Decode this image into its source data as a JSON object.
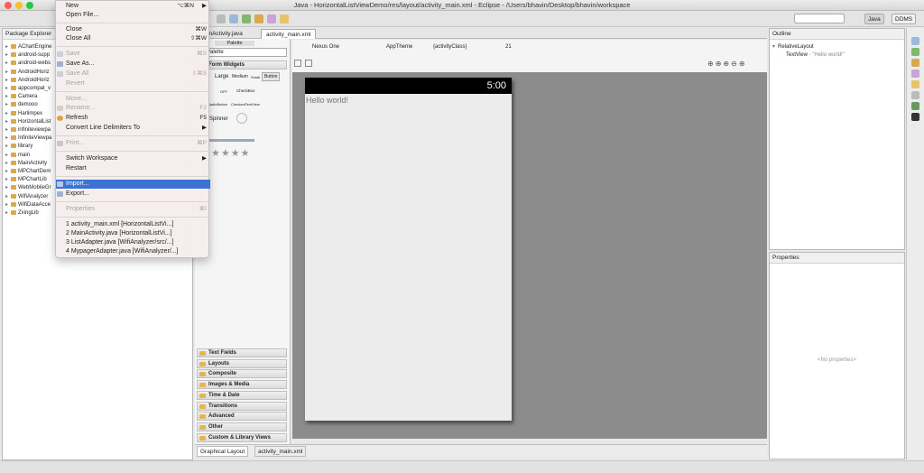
{
  "window": {
    "title": "Java - HorizontalListViewDemo/res/layout/activity_main.xml - Eclipse - /Users/bhavin/Desktop/bhavin/workspace"
  },
  "toolbar": {
    "perspectives": [
      {
        "label": "Java",
        "active": true
      },
      {
        "label": "DDMS",
        "active": false
      }
    ]
  },
  "package_explorer": {
    "title": "Package Explorer",
    "items": [
      "AChartEngine",
      "android-supp",
      "android-webs",
      "AndroidHoriz",
      "AndroidHoriz",
      "appcompat_v",
      "Camera",
      "demooo",
      "Harlimpex",
      "HorizontalList",
      "infiniteviewpa",
      "InfiniteViewpa",
      "library",
      "main",
      "MainActivity",
      "MPChartDem",
      "MPChartLib",
      "WebMobileGr",
      "WifiAnalyzer",
      "WifiDataAcce",
      "ZxingLib"
    ]
  },
  "menu": {
    "new": {
      "label": "New",
      "shortcut": "⌥⌘N",
      "submenu": "▶"
    },
    "open_file": {
      "label": "Open File..."
    },
    "close": {
      "label": "Close",
      "shortcut": "⌘W"
    },
    "close_all": {
      "label": "Close All",
      "shortcut": "⇧⌘W"
    },
    "save": {
      "label": "Save",
      "shortcut": "⌘S"
    },
    "save_as": {
      "label": "Save As..."
    },
    "save_all": {
      "label": "Save All",
      "shortcut": "⇧⌘S"
    },
    "revert": {
      "label": "Revert"
    },
    "move": {
      "label": "Move..."
    },
    "rename": {
      "label": "Rename...",
      "shortcut": "F2"
    },
    "refresh": {
      "label": "Refresh",
      "shortcut": "F5"
    },
    "convert": {
      "label": "Convert Line Delimiters To",
      "submenu": "▶"
    },
    "print": {
      "label": "Print...",
      "shortcut": "⌘P"
    },
    "switch_workspace": {
      "label": "Switch Workspace",
      "submenu": "▶"
    },
    "restart": {
      "label": "Restart"
    },
    "import": {
      "label": "Import..."
    },
    "export": {
      "label": "Export..."
    },
    "properties": {
      "label": "Properties",
      "shortcut": "⌘I"
    },
    "recent": [
      "1 activity_main.xml  [HorizontalListVi...]",
      "2 MainActivity.java  [HorizontalListVi...]",
      "3 ListAdapter.java  [WifiAnalyzer/src/...]",
      "4 MypagerAdapter.java  [WifiAnalyzer/...]"
    ]
  },
  "editor": {
    "tabs": [
      {
        "label": "MainActivity.java",
        "active": false
      },
      {
        "label": "activity_main.xml",
        "active": true
      }
    ],
    "bottom_tabs": [
      "Graphical Layout",
      "activity_main.xml"
    ],
    "canvas_toolbar": {
      "device": "Nexus One",
      "theme": "AppTheme",
      "activity": "{activityClass}",
      "api": "21"
    },
    "phone": {
      "clock": "5:00",
      "text": "Hello world!"
    }
  },
  "palette": {
    "title": "Palette",
    "select": "Palette",
    "form_widgets_header": "Form Widgets",
    "widget_labels": [
      "Large",
      "Medium",
      "Small",
      "Button",
      "OFF",
      "CheckBox",
      "RadioButton",
      "CheckedTextView",
      "Spinner"
    ],
    "groups": [
      "Text Fields",
      "Layouts",
      "Composite",
      "Images & Media",
      "Time & Date",
      "Transitions",
      "Advanced",
      "Other",
      "Custom & Library Views"
    ]
  },
  "outline": {
    "title": "Outline",
    "root": "RelativeLayout",
    "child": "TextView",
    "child_value": "- \"Hello world!\""
  },
  "properties": {
    "title": "Properties",
    "empty": "<No properties>"
  }
}
